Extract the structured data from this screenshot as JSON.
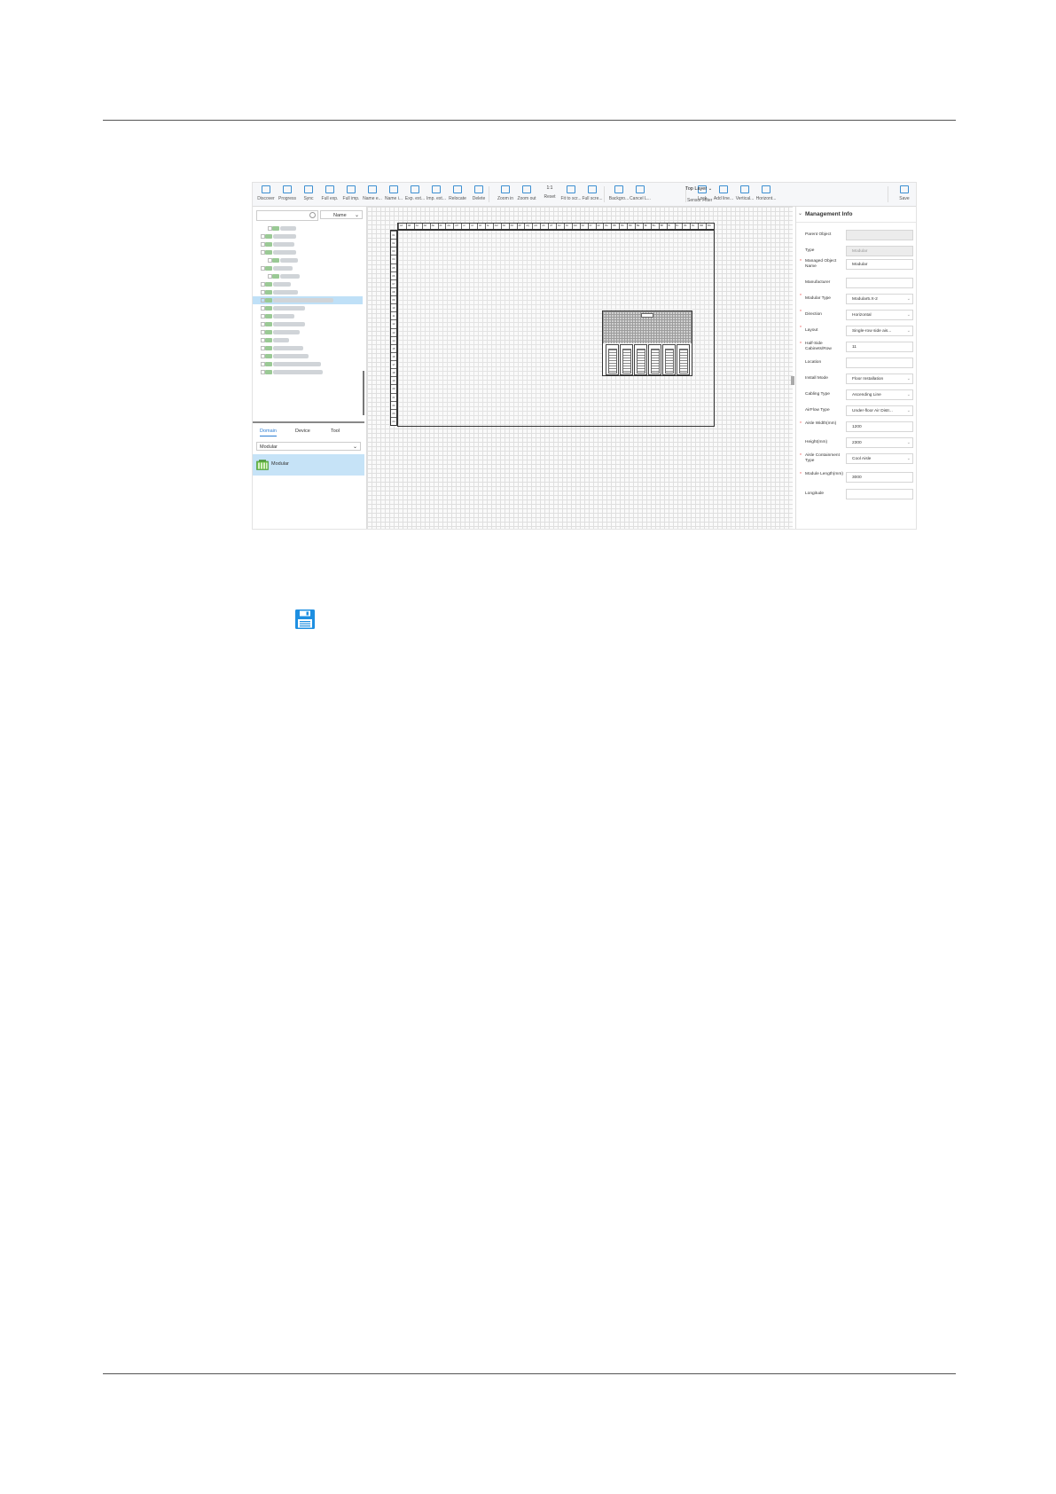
{
  "toolbar": {
    "buttons": [
      "Discover",
      "Progress",
      "Sync",
      "Full exp.",
      "Full imp.",
      "Name e...",
      "Name i...",
      "Exp. ext...",
      "Imp. ext...",
      "Relocate",
      "Delete",
      "Zoom in",
      "Zoom out",
      "Reset",
      "Fit to scr...",
      "Full scre...",
      "Backgro...",
      "Cancel L...",
      "Lock",
      "Add line...",
      "Vertical...",
      "Horizont...",
      "Save"
    ],
    "reset_glyph": "1:1",
    "layer_select": "Top Layer",
    "sensor_filter": "Sensor Filter"
  },
  "left_panel": {
    "search_placeholder": "",
    "name_select": "Name",
    "tabs": [
      "Domain",
      "Device",
      "Tool"
    ],
    "active_tab": "Domain",
    "category_select": "Modular",
    "palette_item": "Modular"
  },
  "management": {
    "title": "Management Info",
    "fields": [
      {
        "label": "Parent Object",
        "value": "",
        "readonly": true,
        "required": false,
        "dropdown": false
      },
      {
        "label": "Type",
        "value": "Modular",
        "readonly": true,
        "required": false,
        "dropdown": false
      },
      {
        "label": "Managed Object Name",
        "value": "Modular",
        "readonly": false,
        "required": true,
        "dropdown": false
      },
      {
        "label": "Manufacturer",
        "value": "",
        "readonly": false,
        "required": false,
        "dropdown": false
      },
      {
        "label": "Modular Type",
        "value": "Modular5.X-2",
        "readonly": false,
        "required": true,
        "dropdown": true
      },
      {
        "label": "Direction",
        "value": "Horizontal",
        "readonly": false,
        "required": true,
        "dropdown": true
      },
      {
        "label": "Layout",
        "value": "Single-row side ais...",
        "readonly": false,
        "required": true,
        "dropdown": true
      },
      {
        "label": "Half-Side Cabinets/Row",
        "value": "11",
        "readonly": false,
        "required": true,
        "dropdown": false
      },
      {
        "label": "Location",
        "value": "",
        "readonly": false,
        "required": false,
        "dropdown": false
      },
      {
        "label": "Install Mode",
        "value": "Floor Installation",
        "readonly": false,
        "required": false,
        "dropdown": true
      },
      {
        "label": "Cabling Type",
        "value": "Ascending Line",
        "readonly": false,
        "required": false,
        "dropdown": true
      },
      {
        "label": "AirFlow Type",
        "value": "Under-floor Air Distr...",
        "readonly": false,
        "required": false,
        "dropdown": true
      },
      {
        "label": "Aisle Width(mm)",
        "value": "1200",
        "readonly": false,
        "required": true,
        "dropdown": false
      },
      {
        "label": "Height(mm)",
        "value": "2300",
        "readonly": false,
        "required": false,
        "dropdown": true
      },
      {
        "label": "Aisle Containment Type",
        "value": "Cool Aisle",
        "readonly": false,
        "required": true,
        "dropdown": true
      },
      {
        "label": "Module Length(mm)",
        "value": "3000",
        "readonly": false,
        "required": true,
        "dropdown": false
      },
      {
        "label": "Longitude",
        "value": "",
        "readonly": false,
        "required": false,
        "dropdown": false
      }
    ]
  },
  "canvas": {
    "columns": [
      "AA",
      "AB",
      "AC",
      "AD",
      "AE",
      "AF",
      "AG",
      "AH",
      "AI",
      "AJ",
      "AK",
      "AL",
      "AM",
      "AN",
      "AO",
      "AP",
      "AQ",
      "AR",
      "AS",
      "AT",
      "AU",
      "AV",
      "AW",
      "AX",
      "AY",
      "AZ",
      "BA",
      "BB",
      "BC",
      "BD",
      "BE",
      "BF",
      "BG",
      "BH",
      "BI",
      "BJ",
      "BK",
      "BL",
      "BM",
      "BN"
    ],
    "rows": [
      "01",
      "02",
      "03",
      "04",
      "05",
      "06",
      "07",
      "08",
      "09",
      "10",
      "11",
      "12",
      "13",
      "14",
      "15",
      "16",
      "17",
      "18",
      "19",
      "20",
      "21",
      "22",
      "23",
      "24"
    ],
    "cabinet_count": 6
  },
  "colors": {
    "accent": "#2d7ed3",
    "selection": "#bfe0f7",
    "save_icon": "#1e8fe1"
  }
}
